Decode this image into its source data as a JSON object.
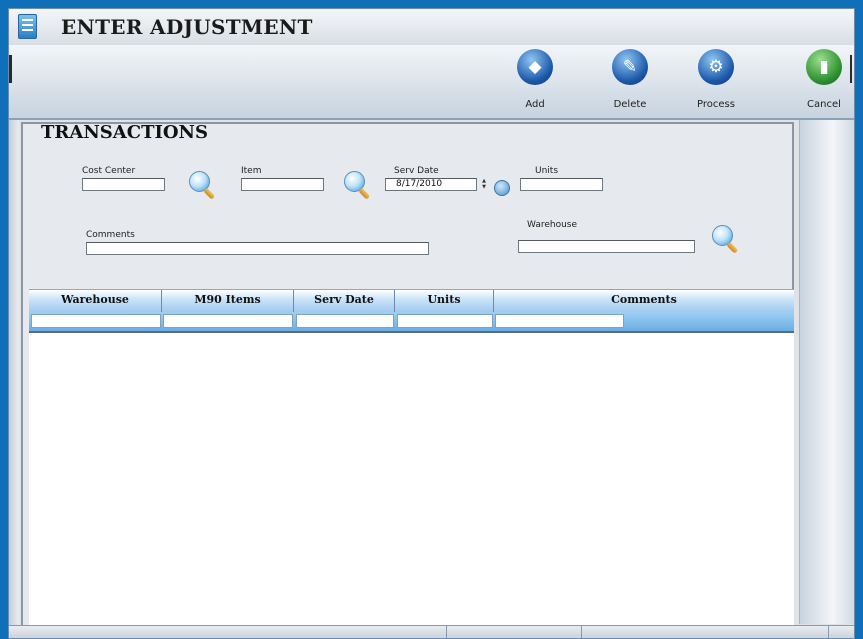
{
  "window": {
    "title": "ENTER ADJUSTMENT",
    "title_icon": "document-icon"
  },
  "toolbar": {
    "buttons": [
      {
        "label": "Add",
        "icon": "add-disk-icon"
      },
      {
        "label": "Delete",
        "icon": "delete-pencil-icon"
      },
      {
        "label": "Process",
        "icon": "process-gear-icon"
      },
      {
        "label": "Cancel",
        "icon": "exit-door-icon"
      }
    ]
  },
  "section": {
    "title": "TRANSACTIONS"
  },
  "form": {
    "cost_center": {
      "label": "Cost Center",
      "value": ""
    },
    "item": {
      "label": "Item",
      "value": ""
    },
    "serv_date": {
      "label": "Serv Date",
      "value": "8/17/2010"
    },
    "units": {
      "label": "Units",
      "value": ""
    },
    "comments": {
      "label": "Comments",
      "value": ""
    },
    "warehouse": {
      "label": "Warehouse",
      "value": ""
    }
  },
  "grid": {
    "columns": [
      "Warehouse",
      "M90 Items",
      "Serv Date",
      "Units",
      "Comments"
    ],
    "rows": []
  },
  "colors": {
    "accent": "#1b57a8",
    "background": "#0f6fb8",
    "cancel": "#2c8f2f"
  }
}
